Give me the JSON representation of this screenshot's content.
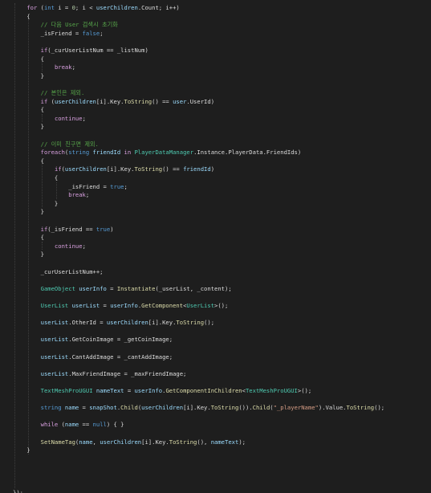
{
  "colors": {
    "background": "#1e1e1e",
    "keyword": "#569cd6",
    "control": "#d8a0df",
    "type": "#4ec9b0",
    "number": "#b5cea8",
    "string": "#d69d85",
    "comment": "#57a64a",
    "identifier": "#9cdcfe",
    "method": "#dcdcaa",
    "text": "#dcdcdc",
    "guide": "#3f3f3f"
  },
  "code": {
    "lines": [
      [
        [
          "    ",
          "txt"
        ],
        [
          "for",
          "ctl"
        ],
        [
          " (",
          "txt"
        ],
        [
          "int",
          "kw"
        ],
        [
          " i = ",
          "txt"
        ],
        [
          "0",
          "num"
        ],
        [
          "; i < ",
          "txt"
        ],
        [
          "userChildren",
          "id"
        ],
        [
          ".Count; i++)",
          "txt"
        ]
      ],
      [
        [
          "    {",
          "txt"
        ]
      ],
      [
        [
          "        ",
          "txt"
        ],
        [
          "// 다음 User 검색시 초기화",
          "com"
        ]
      ],
      [
        [
          "        _isFriend = ",
          "txt"
        ],
        [
          "false",
          "kw"
        ],
        [
          ";",
          "txt"
        ]
      ],
      [
        [
          "",
          "txt"
        ]
      ],
      [
        [
          "        ",
          "txt"
        ],
        [
          "if",
          "ctl"
        ],
        [
          "(_curUserListNum == _listNum)",
          "txt"
        ]
      ],
      [
        [
          "        {",
          "txt"
        ]
      ],
      [
        [
          "            ",
          "txt"
        ],
        [
          "break",
          "ctl"
        ],
        [
          ";",
          "txt"
        ]
      ],
      [
        [
          "        }",
          "txt"
        ]
      ],
      [
        [
          "",
          "txt"
        ]
      ],
      [
        [
          "        ",
          "txt"
        ],
        [
          "// 본인은 제외.",
          "com"
        ]
      ],
      [
        [
          "        ",
          "txt"
        ],
        [
          "if",
          "ctl"
        ],
        [
          " (",
          "txt"
        ],
        [
          "userChildren",
          "id"
        ],
        [
          "[i].Key.",
          "txt"
        ],
        [
          "ToString",
          "mth"
        ],
        [
          "() == ",
          "txt"
        ],
        [
          "user",
          "id"
        ],
        [
          ".UserId)",
          "txt"
        ]
      ],
      [
        [
          "        {",
          "txt"
        ]
      ],
      [
        [
          "            ",
          "txt"
        ],
        [
          "continue",
          "ctl"
        ],
        [
          ";",
          "txt"
        ]
      ],
      [
        [
          "        }",
          "txt"
        ]
      ],
      [
        [
          "",
          "txt"
        ]
      ],
      [
        [
          "        ",
          "txt"
        ],
        [
          "// 이미 친구면 제외.",
          "com"
        ]
      ],
      [
        [
          "        ",
          "txt"
        ],
        [
          "foreach",
          "ctl"
        ],
        [
          "(",
          "txt"
        ],
        [
          "string",
          "kw"
        ],
        [
          " ",
          "txt"
        ],
        [
          "friendId",
          "id"
        ],
        [
          " ",
          "txt"
        ],
        [
          "in",
          "ctl"
        ],
        [
          " ",
          "txt"
        ],
        [
          "PlayerDataManager",
          "type"
        ],
        [
          ".Instance.PlayerData.FriendIds)",
          "txt"
        ]
      ],
      [
        [
          "        {",
          "txt"
        ]
      ],
      [
        [
          "            ",
          "txt"
        ],
        [
          "if",
          "ctl"
        ],
        [
          "(",
          "txt"
        ],
        [
          "userChildren",
          "id"
        ],
        [
          "[i].Key.",
          "txt"
        ],
        [
          "ToString",
          "mth"
        ],
        [
          "() == ",
          "txt"
        ],
        [
          "friendId",
          "id"
        ],
        [
          ")",
          "txt"
        ]
      ],
      [
        [
          "            {",
          "txt"
        ]
      ],
      [
        [
          "                _isFriend = ",
          "txt"
        ],
        [
          "true",
          "kw"
        ],
        [
          ";",
          "txt"
        ]
      ],
      [
        [
          "                ",
          "txt"
        ],
        [
          "break",
          "ctl"
        ],
        [
          ";",
          "txt"
        ]
      ],
      [
        [
          "            }",
          "txt"
        ]
      ],
      [
        [
          "        }",
          "txt"
        ]
      ],
      [
        [
          "",
          "txt"
        ]
      ],
      [
        [
          "        ",
          "txt"
        ],
        [
          "if",
          "ctl"
        ],
        [
          "(_isFriend == ",
          "txt"
        ],
        [
          "true",
          "kw"
        ],
        [
          ")",
          "txt"
        ]
      ],
      [
        [
          "        {",
          "txt"
        ]
      ],
      [
        [
          "            ",
          "txt"
        ],
        [
          "continue",
          "ctl"
        ],
        [
          ";",
          "txt"
        ]
      ],
      [
        [
          "        }",
          "txt"
        ]
      ],
      [
        [
          "",
          "txt"
        ]
      ],
      [
        [
          "        _curUserListNum++;",
          "txt"
        ]
      ],
      [
        [
          "",
          "txt"
        ]
      ],
      [
        [
          "        ",
          "txt"
        ],
        [
          "GameObject",
          "type"
        ],
        [
          " ",
          "txt"
        ],
        [
          "userInfo",
          "id"
        ],
        [
          " = ",
          "txt"
        ],
        [
          "Instantiate",
          "mth"
        ],
        [
          "(_userList, _content);",
          "txt"
        ]
      ],
      [
        [
          "",
          "txt"
        ]
      ],
      [
        [
          "        ",
          "txt"
        ],
        [
          "UserList",
          "type"
        ],
        [
          " ",
          "txt"
        ],
        [
          "userList",
          "id"
        ],
        [
          " = ",
          "txt"
        ],
        [
          "userInfo",
          "id"
        ],
        [
          ".",
          "txt"
        ],
        [
          "GetComponent",
          "mth"
        ],
        [
          "<",
          "txt"
        ],
        [
          "UserList",
          "type"
        ],
        [
          ">();",
          "txt"
        ]
      ],
      [
        [
          "",
          "txt"
        ]
      ],
      [
        [
          "        ",
          "txt"
        ],
        [
          "userList",
          "id"
        ],
        [
          ".OtherId = ",
          "txt"
        ],
        [
          "userChildren",
          "id"
        ],
        [
          "[i].Key.",
          "txt"
        ],
        [
          "ToString",
          "mth"
        ],
        [
          "();",
          "txt"
        ]
      ],
      [
        [
          "",
          "txt"
        ]
      ],
      [
        [
          "        ",
          "txt"
        ],
        [
          "userList",
          "id"
        ],
        [
          ".GetCoinImage = _getCoinImage;",
          "txt"
        ]
      ],
      [
        [
          "",
          "txt"
        ]
      ],
      [
        [
          "        ",
          "txt"
        ],
        [
          "userList",
          "id"
        ],
        [
          ".CantAddImage = _cantAddImage;",
          "txt"
        ]
      ],
      [
        [
          "",
          "txt"
        ]
      ],
      [
        [
          "        ",
          "txt"
        ],
        [
          "userList",
          "id"
        ],
        [
          ".MaxFriendImage = _maxFriendImage;",
          "txt"
        ]
      ],
      [
        [
          "",
          "txt"
        ]
      ],
      [
        [
          "        ",
          "txt"
        ],
        [
          "TextMeshProUGUI",
          "type"
        ],
        [
          " ",
          "txt"
        ],
        [
          "nameText",
          "id"
        ],
        [
          " = ",
          "txt"
        ],
        [
          "userInfo",
          "id"
        ],
        [
          ".",
          "txt"
        ],
        [
          "GetComponentInChildren",
          "mth"
        ],
        [
          "<",
          "txt"
        ],
        [
          "TextMeshProUGUI",
          "type"
        ],
        [
          ">();",
          "txt"
        ]
      ],
      [
        [
          "",
          "txt"
        ]
      ],
      [
        [
          "        ",
          "txt"
        ],
        [
          "string",
          "kw"
        ],
        [
          " ",
          "txt"
        ],
        [
          "name",
          "id"
        ],
        [
          " = ",
          "txt"
        ],
        [
          "snapShot",
          "id"
        ],
        [
          ".",
          "txt"
        ],
        [
          "Child",
          "mth"
        ],
        [
          "(",
          "txt"
        ],
        [
          "userChildren",
          "id"
        ],
        [
          "[i].Key.",
          "txt"
        ],
        [
          "ToString",
          "mth"
        ],
        [
          "()).",
          "txt"
        ],
        [
          "Child",
          "mth"
        ],
        [
          "(",
          "txt"
        ],
        [
          "\"_playerName\"",
          "str"
        ],
        [
          ").Value.",
          "txt"
        ],
        [
          "ToString",
          "mth"
        ],
        [
          "();",
          "txt"
        ]
      ],
      [
        [
          "",
          "txt"
        ]
      ],
      [
        [
          "        ",
          "txt"
        ],
        [
          "while",
          "ctl"
        ],
        [
          " (",
          "txt"
        ],
        [
          "name",
          "id"
        ],
        [
          " == ",
          "txt"
        ],
        [
          "null",
          "kw"
        ],
        [
          ") { }",
          "txt"
        ]
      ],
      [
        [
          "",
          "txt"
        ]
      ],
      [
        [
          "        ",
          "txt"
        ],
        [
          "SetNameTag",
          "mth"
        ],
        [
          "(",
          "txt"
        ],
        [
          "name",
          "id"
        ],
        [
          ", ",
          "txt"
        ],
        [
          "userChildren",
          "id"
        ],
        [
          "[i].Key.",
          "txt"
        ],
        [
          "ToString",
          "mth"
        ],
        [
          "(), ",
          "txt"
        ],
        [
          "nameText",
          "id"
        ],
        [
          ");",
          "txt"
        ]
      ],
      [
        [
          "    }",
          "txt"
        ]
      ],
      [
        [
          "",
          "txt"
        ]
      ],
      [
        [
          "",
          "txt"
        ]
      ],
      [
        [
          "",
          "txt"
        ]
      ],
      [
        [
          "",
          "txt"
        ]
      ],
      [
        [
          "});",
          "txt"
        ]
      ]
    ]
  }
}
